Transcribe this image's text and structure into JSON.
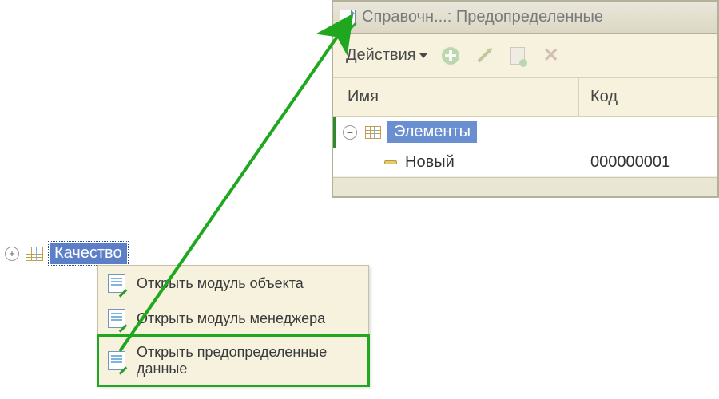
{
  "window": {
    "title": "Справочн...: Предопределенные",
    "actions_label": "Действия",
    "columns": {
      "name": "Имя",
      "code": "Код"
    },
    "rows": [
      {
        "label": "Элементы",
        "code": "",
        "expanded": true,
        "selected": true
      },
      {
        "label": "Новый",
        "code": "000000001"
      }
    ]
  },
  "tree": {
    "node_label": "Качество"
  },
  "context_menu": {
    "items": [
      {
        "label": "Открыть модуль объекта",
        "highlight": false
      },
      {
        "label": "Открыть модуль менеджера",
        "highlight": false
      },
      {
        "label": "Открыть предопределенные данные",
        "highlight": true
      }
    ]
  },
  "icons": {
    "title_icon": "catalog-predefined-icon",
    "add": "add-icon",
    "edit": "edit-icon",
    "copy": "copy-add-icon",
    "delete": "delete-icon"
  }
}
